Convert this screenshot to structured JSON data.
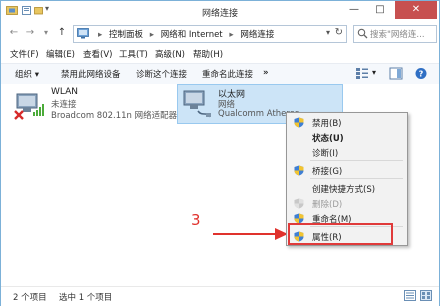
{
  "window": {
    "title": "网络连接",
    "min_glyph": "—",
    "max_glyph": "□",
    "close_glyph": "✕"
  },
  "nav": {
    "back_glyph": "←",
    "forward_glyph": "→",
    "recent_glyph": "▾",
    "up_glyph": "↑"
  },
  "address": {
    "crumbs": [
      "控制面板",
      "网络和 Internet",
      "网络连接"
    ],
    "separator": "▸",
    "dropdown_glyph": "▾",
    "refresh_glyph": "↻"
  },
  "search": {
    "placeholder": "搜索\"网络连..."
  },
  "menu": {
    "items": [
      "文件(F)",
      "编辑(E)",
      "查看(V)",
      "工具(T)",
      "高级(N)",
      "帮助(H)"
    ]
  },
  "toolbar": {
    "organize": "组织 ▾",
    "disable": "禁用此网络设备",
    "diagnose": "诊断这个连接",
    "rename": "重命名此连接",
    "more": "»",
    "view_dd": "▾"
  },
  "adapters": [
    {
      "name": "WLAN",
      "status": "未连接",
      "device": "Broadcom 802.11n 网络适配器"
    },
    {
      "name": "以太网",
      "status": "网络",
      "device": "Qualcomm Atheros"
    }
  ],
  "context_menu": {
    "items": [
      {
        "label": "禁用(B)",
        "shield": true,
        "bold": false,
        "disabled": false
      },
      {
        "label": "状态(U)",
        "shield": false,
        "bold": true,
        "disabled": false
      },
      {
        "label": "诊断(I)",
        "shield": false,
        "bold": false,
        "disabled": false
      },
      {
        "label": "桥接(G)",
        "shield": true,
        "bold": false,
        "disabled": false
      },
      {
        "label": "创建快捷方式(S)",
        "shield": false,
        "bold": false,
        "disabled": false
      },
      {
        "label": "删除(D)",
        "shield": true,
        "bold": false,
        "disabled": true
      },
      {
        "label": "重命名(M)",
        "shield": true,
        "bold": false,
        "disabled": false
      },
      {
        "label": "属性(R)",
        "shield": true,
        "bold": false,
        "disabled": false
      }
    ]
  },
  "annotation": {
    "step": "3",
    "color": "#e0322d"
  },
  "status": {
    "count": "2 个项目",
    "selected": "选中 1 个项目"
  },
  "colors": {
    "accent": "#99c9ef",
    "selection": "#cce4f7",
    "close_red": "#c75050"
  }
}
